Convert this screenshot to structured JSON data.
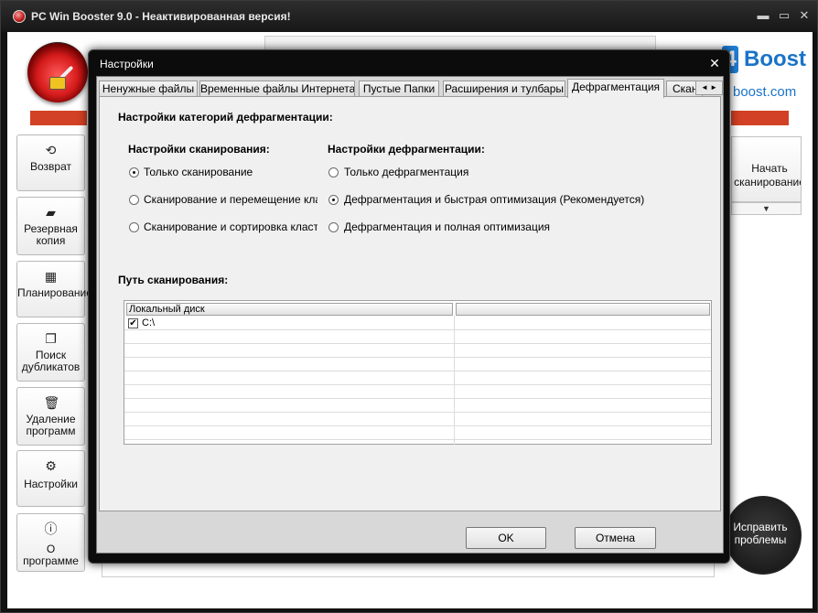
{
  "app": {
    "title": "PC Win Booster 9.0 - Неактивированная версия!",
    "window_controls": {
      "minimize": "▬",
      "maximize": "▭",
      "close": "✕"
    },
    "brand": {
      "badge": "4",
      "name": "Boost",
      "url": "boost.com"
    }
  },
  "sidebar": {
    "items": [
      {
        "label": "Возврат",
        "icon": "restore-icon",
        "glyph": "⟲"
      },
      {
        "label": "Резервная копия",
        "icon": "backup-icon",
        "glyph": "▰"
      },
      {
        "label": "Планирование",
        "icon": "calendar-icon",
        "glyph": "▦"
      },
      {
        "label": "Поиск дубликатов",
        "icon": "duplicate-icon",
        "glyph": "❐"
      },
      {
        "label": "Удаление программ",
        "icon": "trash-icon",
        "glyph": "🗑"
      },
      {
        "label": "Настройки",
        "icon": "gear-icon",
        "glyph": "⚙"
      },
      {
        "label": "О программе",
        "icon": "info-icon",
        "glyph": "ⓘ"
      }
    ]
  },
  "right_panel": {
    "start_scan": "Начать сканирование",
    "start_scan_arrow": "▼",
    "fix_problems": "Исправить проблемы"
  },
  "dialog": {
    "title": "Настройки",
    "close": "✕",
    "tabs": [
      {
        "label": "Ненужные файлы",
        "active": false
      },
      {
        "label": "Временные файлы Интернета",
        "active": false
      },
      {
        "label": "Пустые Папки",
        "active": false
      },
      {
        "label": "Расширения и тулбары",
        "active": false
      },
      {
        "label": "Дефрагментация",
        "active": true
      },
      {
        "label": "Скан",
        "active": false
      }
    ],
    "tab_scroll": "◄ ►",
    "panel": {
      "heading": "Настройки категорий дефрагментации:",
      "scan_group": {
        "title": "Настройки сканирования:",
        "options": [
          {
            "label": "Только сканирование",
            "selected": true
          },
          {
            "label": "Сканирование и перемещение кластеров",
            "selected": false
          },
          {
            "label": "Сканирование и сортировка кластеров",
            "selected": false
          }
        ]
      },
      "defrag_group": {
        "title": "Настройки дефрагментации:",
        "options": [
          {
            "label": "Только дефрагментация",
            "selected": false
          },
          {
            "label": "Дефрагментация и быстрая оптимизация (Рекомендуется)",
            "selected": true
          },
          {
            "label": "Дефрагментация и полная оптимизация",
            "selected": false
          }
        ]
      },
      "path_heading": "Путь сканирования:",
      "grid": {
        "columns": [
          "Локальный диск",
          ""
        ],
        "rows": [
          {
            "checked": true,
            "check_glyph": "✔",
            "name": "C:\\"
          }
        ]
      }
    },
    "buttons": {
      "ok": "OK",
      "cancel": "Отмена"
    }
  }
}
